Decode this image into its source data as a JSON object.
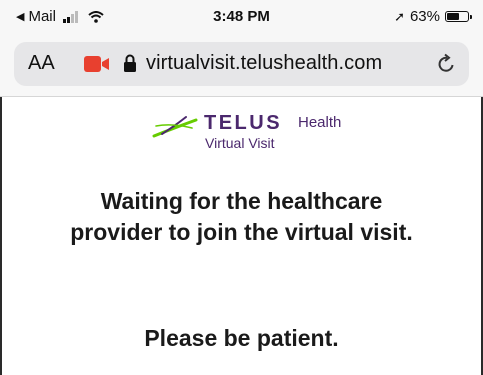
{
  "status_bar": {
    "back_app": "Mail",
    "time": "3:48 PM",
    "battery_percent": "63%",
    "battery_level": 0.63
  },
  "address_bar": {
    "text_size_label": "AA",
    "url": "virtualvisit.telushealth.com",
    "icons": [
      "video-camera-icon",
      "lock-icon",
      "reload-icon"
    ]
  },
  "brand": {
    "name": "TELUS",
    "suffix": "Health",
    "product": "Virtual Visit",
    "color": "#4b286d",
    "accent": "#66cc00"
  },
  "main": {
    "waiting_line1": "Waiting for the healthcare",
    "waiting_line2": "provider to join the virtual visit.",
    "patience": "Please be patient."
  }
}
